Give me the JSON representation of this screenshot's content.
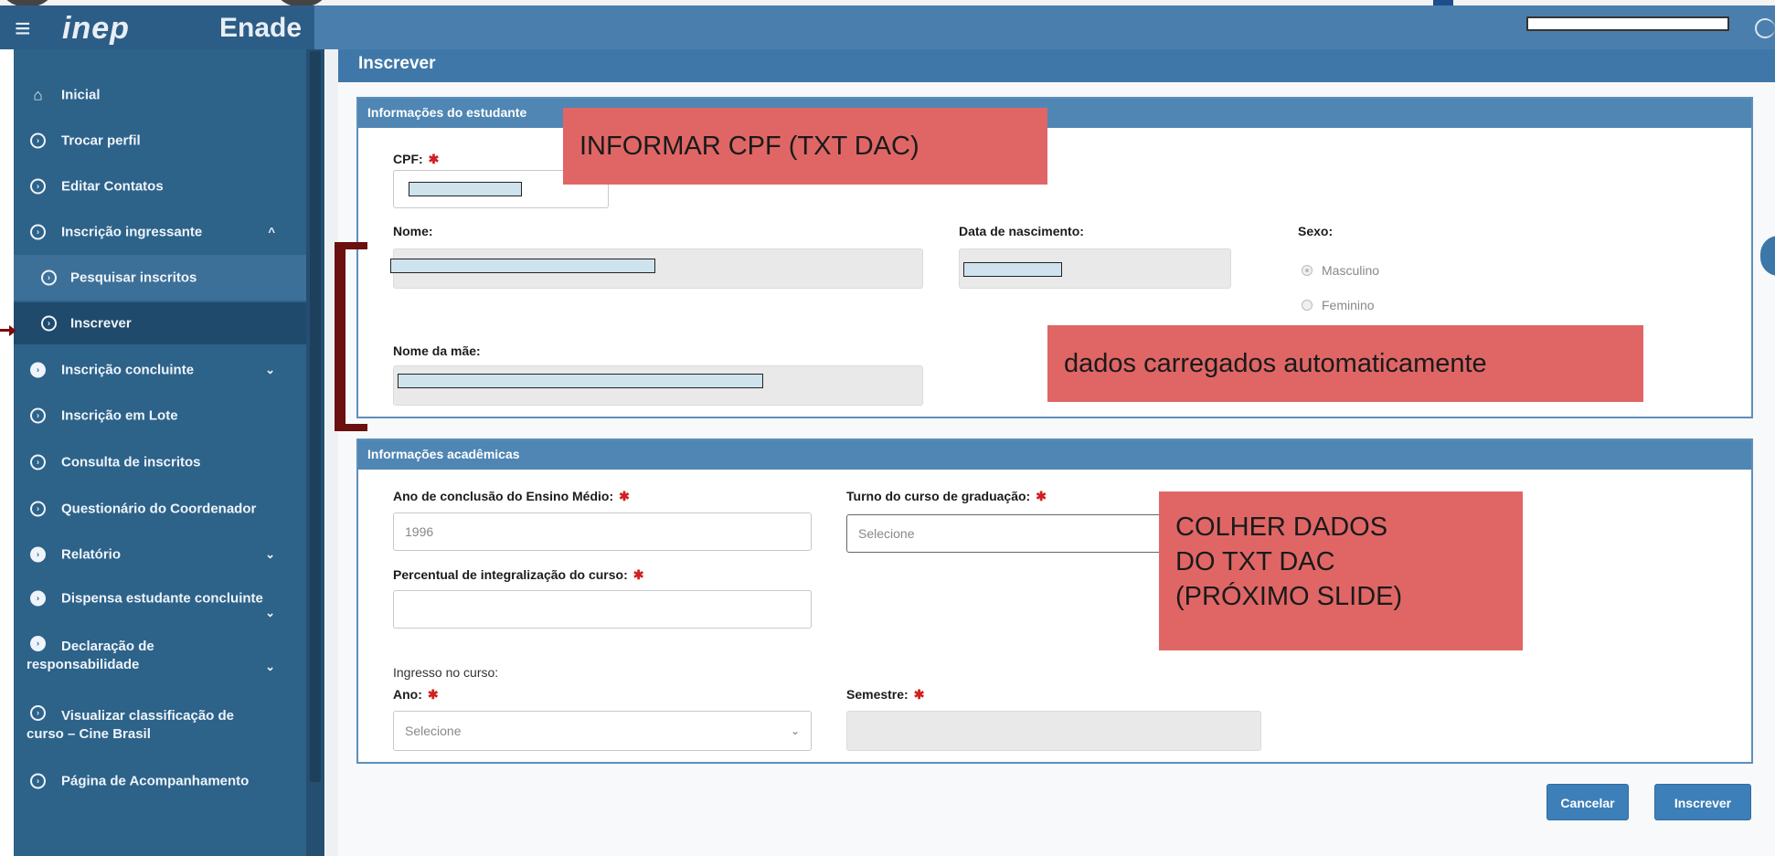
{
  "header": {
    "menu_icon": "hamburger-icon",
    "logo": "inep",
    "app_name": "Enade"
  },
  "sidebar": {
    "items": [
      {
        "label": "Inicial",
        "icon": "home-icon"
      },
      {
        "label": "Trocar perfil",
        "icon": "circle-arrow-icon"
      },
      {
        "label": "Editar Contatos",
        "icon": "circle-arrow-icon"
      },
      {
        "label": "Inscrição ingressante",
        "icon": "circle-arrow-icon",
        "chevron": "^"
      },
      {
        "label": "Pesquisar inscritos",
        "icon": "circle-arrow-icon"
      },
      {
        "label": "Inscrever",
        "icon": "circle-arrow-icon"
      },
      {
        "label": "Inscrição concluinte",
        "icon": "circle-arrow-icon",
        "chevron": "⌄"
      },
      {
        "label": "Inscrição em Lote",
        "icon": "circle-arrow-icon"
      },
      {
        "label": "Consulta de inscritos",
        "icon": "circle-arrow-icon"
      },
      {
        "label": "Questionário do Coordenador",
        "icon": "circle-arrow-icon"
      },
      {
        "label": "Relatório",
        "icon": "circle-arrow-icon",
        "chevron": "⌄"
      },
      {
        "label": "Dispensa estudante concluinte",
        "icon": "circle-arrow-icon",
        "chevron": "⌄"
      },
      {
        "label_line1": "Declaração de",
        "label_line2": "responsabilidade",
        "icon": "circle-arrow-icon",
        "chevron": "⌄"
      },
      {
        "label_line1": "Visualizar classificação de",
        "label_line2": "curso – Cine Brasil",
        "icon": "circle-arrow-icon"
      },
      {
        "label": "Página de Acompanhamento",
        "icon": "circle-arrow-icon"
      }
    ]
  },
  "main": {
    "title": "Inscrever",
    "student_panel": {
      "title": "Informações do estudante",
      "cpf_label": "CPF:",
      "nome_label": "Nome:",
      "nascimento_label": "Data de nascimento:",
      "sexo_label": "Sexo:",
      "sexo_options": [
        "Masculino",
        "Feminino"
      ],
      "sexo_selected": "Masculino",
      "mae_label": "Nome da mãe:"
    },
    "academic_panel": {
      "title": "Informações acadêmicas",
      "ano_conclusao_label": "Ano de conclusão do Ensino Médio:",
      "ano_conclusao_value": "1996",
      "turno_label": "Turno do curso de graduação:",
      "turno_placeholder": "Selecione",
      "percentual_label": "Percentual de integralização do curso:",
      "ingresso_label": "Ingresso no curso:",
      "ano_label": "Ano:",
      "ano_placeholder": "Selecione",
      "semestre_label": "Semestre:"
    },
    "buttons": {
      "cancel": "Cancelar",
      "submit": "Inscrever"
    }
  },
  "annotations": {
    "cpf_note": "INFORMAR CPF (TXT DAC)",
    "auto_note": "dados carregados automaticamente",
    "collect_note": [
      "COLHER DADOS",
      "DO TXT DAC",
      "(PRÓXIMO SLIDE)"
    ]
  },
  "colors": {
    "sidebar": "#2d6289",
    "header": "#4a7fad",
    "note": "#e06666",
    "bracket": "#6b0f0f",
    "button": "#3d7fb8"
  }
}
